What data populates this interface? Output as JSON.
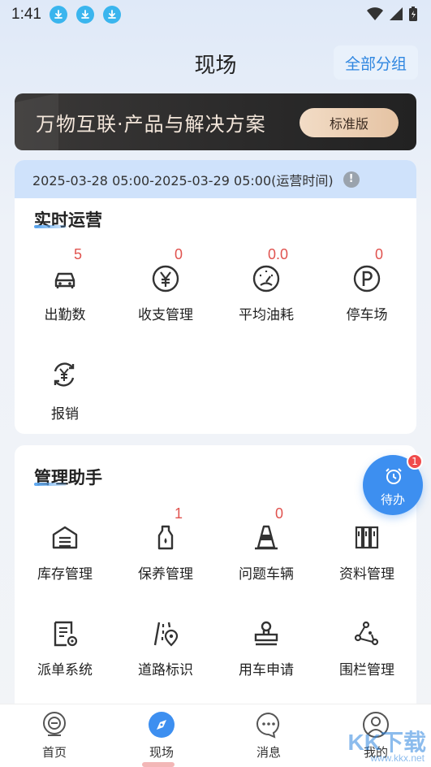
{
  "status": {
    "time": "1:41",
    "notification_icons": [
      "download-icon",
      "download-icon",
      "download-icon"
    ]
  },
  "header": {
    "title": "现场",
    "group_button": "全部分组"
  },
  "banner": {
    "text": "万物互联·产品与解决方案",
    "edition_button": "标准版"
  },
  "operation": {
    "time_range": "2025-03-28 05:00-2025-03-29 05:00(运营时间)",
    "info_icon": "!",
    "title": "实时运营",
    "items": [
      {
        "count": "5",
        "label": "出勤数",
        "icon": "car-icon"
      },
      {
        "count": "0",
        "label": "收支管理",
        "icon": "yuan-icon"
      },
      {
        "count": "0.0",
        "label": "平均油耗",
        "icon": "gauge-icon"
      },
      {
        "count": "0",
        "label": "停车场",
        "icon": "parking-icon"
      },
      {
        "count": "",
        "label": "报销",
        "icon": "reimburse-icon"
      }
    ]
  },
  "assistant": {
    "title": "管理助手",
    "items": [
      {
        "count": "",
        "label": "库存管理",
        "icon": "warehouse-icon"
      },
      {
        "count": "1",
        "label": "保养管理",
        "icon": "oil-bottle-icon"
      },
      {
        "count": "0",
        "label": "问题车辆",
        "icon": "traffic-cone-icon"
      },
      {
        "count": "",
        "label": "资料管理",
        "icon": "books-icon"
      },
      {
        "count": "",
        "label": "派单系统",
        "icon": "dispatch-icon"
      },
      {
        "count": "",
        "label": "道路标识",
        "icon": "road-sign-icon"
      },
      {
        "count": "",
        "label": "用车申请",
        "icon": "stamp-icon"
      },
      {
        "count": "",
        "label": "围栏管理",
        "icon": "fence-icon"
      }
    ]
  },
  "todo": {
    "label": "待办",
    "badge": "1"
  },
  "nav": {
    "items": [
      {
        "label": "首页",
        "icon": "home-icon"
      },
      {
        "label": "现场",
        "icon": "compass-icon"
      },
      {
        "label": "消息",
        "icon": "message-icon"
      },
      {
        "label": "我的",
        "icon": "profile-icon"
      }
    ],
    "active": "现场"
  },
  "watermark": {
    "text": "KK下载",
    "url": "www.kkx.net"
  },
  "colors": {
    "accent": "#2f86e0",
    "count_red": "#e0534f",
    "fab_blue": "#3d8ff0",
    "banner_gold": "#e5c3a3"
  }
}
